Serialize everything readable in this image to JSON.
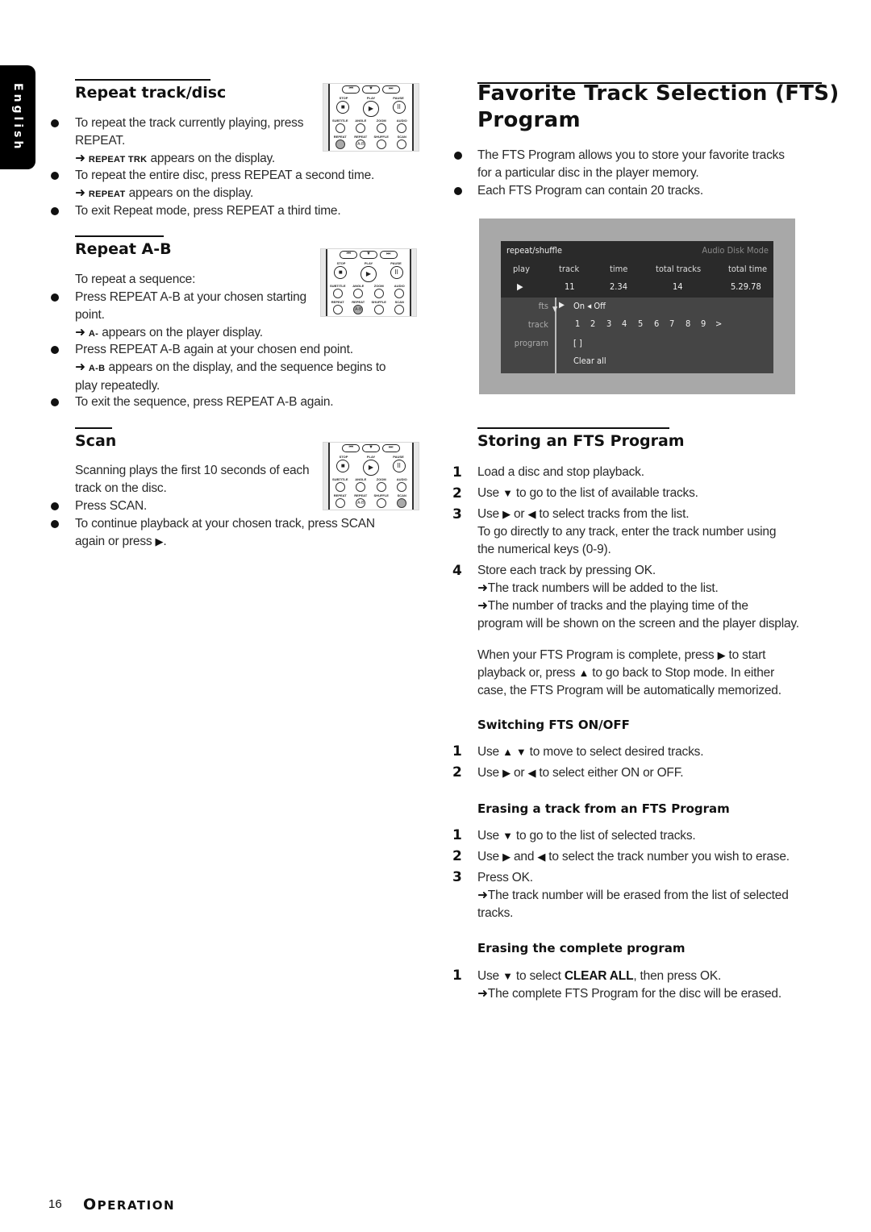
{
  "sidebar": {
    "language_tab": "English"
  },
  "left": {
    "repeat_track": {
      "heading": "Repeat track/disc",
      "b1_l1": "To repeat the track currently playing, press",
      "b1_l2": "REPEAT.",
      "r1_code": "REPEAT TRK",
      "r1_text": " appears on the display.",
      "b2": "To repeat the entire disc, press REPEAT a second time.",
      "r2_code": "REPEAT",
      "r2_text": " appears on the display.",
      "b3": "To exit Repeat mode, press REPEAT a third time."
    },
    "repeat_ab": {
      "heading": "Repeat A-B",
      "intro": "To repeat a sequence:",
      "b1_l1": "Press REPEAT A-B at your chosen starting",
      "b1_l2": "point.",
      "r1_code": "A-",
      "r1_text": " appears on the player display.",
      "b2": "Press REPEAT A-B again at your chosen end point.",
      "r2_code": "A-B",
      "r2_text": " appears on the display, and the sequence begins to",
      "r2_l2": "play repeatedly.",
      "b3": "To exit the sequence, press REPEAT A-B again."
    },
    "scan": {
      "heading": "Scan",
      "intro_l1": "Scanning plays the first 10 seconds of each",
      "intro_l2": "track on the disc.",
      "b1": "Press SCAN.",
      "b2_l1": "To continue playback at your chosen track, press SCAN",
      "b2_l2": "again or press ",
      "b2_end": "."
    }
  },
  "remote": {
    "nav": [
      "⏮",
      "▼",
      "⏭"
    ],
    "row1_labels": [
      "STOP",
      "PLAY",
      "PAUSE"
    ],
    "row1_icons": [
      "■",
      "▶",
      "II"
    ],
    "row2_labels": [
      "SUBTITLE",
      "ANGLE",
      "ZOOM",
      "AUDIO"
    ],
    "row3_labels": [
      "REPEAT",
      "REPEAT",
      "SHUFFLE",
      "SCAN"
    ],
    "ab_label": "A-B"
  },
  "right": {
    "title_l1": "Favorite Track Selection (FTS)",
    "title_l2": "Program",
    "b1_l1": "The FTS Program allows you to store your favorite tracks",
    "b1_l2": "for a particular disc in the player memory.",
    "b2": "Each FTS Program can contain 20 tracks.",
    "osd": {
      "title": "repeat/shuffle",
      "mode": "Audio Disk Mode",
      "headers": [
        "play",
        "track",
        "time",
        "total tracks",
        "total time"
      ],
      "values": [
        "▶",
        "11",
        "2.34",
        "14",
        "5.29.78"
      ],
      "rows": {
        "fts_label": "fts",
        "fts_value": "On ◂ Off",
        "track_label": "track",
        "tracks": [
          "1",
          "2",
          "3",
          "4",
          "5",
          "6",
          "7",
          "8",
          "9",
          ">"
        ],
        "program_label": "program",
        "program_value": "[ ]",
        "clear_all": "Clear all"
      }
    },
    "storing": {
      "heading": "Storing an FTS Program",
      "s1": "Load a disc and stop playback.",
      "s2_a": "Use ",
      "s2_b": " to go to the list of available tracks.",
      "s3_a": "Use ",
      "s3_b": " or ",
      "s3_c": " to select tracks from the list.",
      "s3_l2": "To go directly to any track, enter the track number using",
      "s3_l3": "the numerical keys (0-9).",
      "s4": "Store each track by pressing OK.",
      "s4_r1": "The track numbers will be added to the list.",
      "s4_r2": "The number of tracks and the playing time of the",
      "s4_r2_l2": "program will be shown on the screen and the player display.",
      "p_l1_a": "When your FTS Program is complete, press ",
      "p_l1_b": " to start",
      "p_l2_a": "playback or, press ",
      "p_l2_b": " to go back to Stop mode. In either",
      "p_l3": "case, the FTS Program will be automatically memorized."
    },
    "switching": {
      "heading": "Switching FTS ON/OFF",
      "s1_a": "Use ",
      "s1_b": " to move to select desired tracks.",
      "s2_a": "Use ",
      "s2_b": " or ",
      "s2_c": " to select either ON or OFF."
    },
    "erasing_track": {
      "heading": "Erasing a track from an FTS Program",
      "s1_a": "Use ",
      "s1_b": " to go to the list of selected tracks.",
      "s2_a": "Use ",
      "s2_b": " and ",
      "s2_c": " to select the track number you wish to erase.",
      "s3": "Press OK.",
      "s3_r": "The track number will be erased from the list of selected",
      "s3_r_l2": "tracks."
    },
    "erasing_all": {
      "heading": "Erasing the complete program",
      "s1_a": "Use ",
      "s1_b": " to select ",
      "s1_bold": "CLEAR ALL",
      "s1_c": ", then press OK.",
      "s1_r": "The complete FTS Program for the disc will be erased."
    }
  },
  "symbols": {
    "arrow": "➜",
    "down": "▼",
    "up": "▲",
    "right": "▶",
    "left": "◀"
  },
  "step_numbers": [
    "1",
    "2",
    "3",
    "4"
  ],
  "footer": {
    "page_number": "16",
    "section_cap": "O",
    "section_rest": "PERATION"
  }
}
